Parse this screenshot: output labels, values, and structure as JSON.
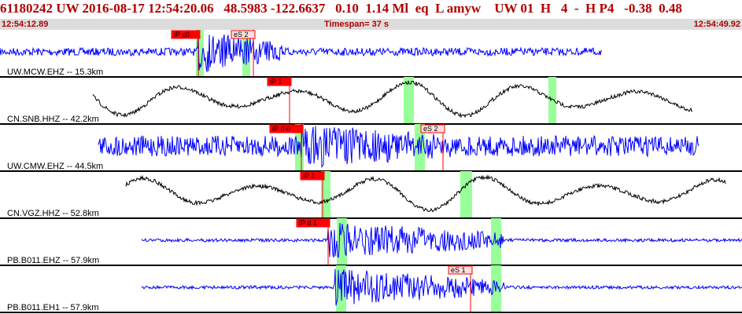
{
  "header": {
    "title": "61180242 UW 2016-08-17 12:54:20.06   48.5983 -122.6637   0.10  1.14 Ml  eq  L amyw    UW 01  H   4  -  H P4   -0.38  0.48",
    "start_time": "12:54:12.89",
    "timespan": "Timespan=  37 s",
    "end_time": "12:54:49.92"
  },
  "colors": {
    "blue": "#0000ff",
    "black": "#000000",
    "red": "#ff0000",
    "green": "#99ff99",
    "header_text": "#b00000"
  },
  "channels": [
    {
      "label": "UW.MCW.EHZ -- 15.3km",
      "color": "blue",
      "kind": "noise",
      "picks": [
        {
          "label": "iP c0",
          "type": "P"
        },
        {
          "label": "eS 2",
          "type": "S"
        }
      ]
    },
    {
      "label": "CN.SNB.HHZ -- 42.2km",
      "color": "black",
      "kind": "wave",
      "picks": [
        {
          "label": "iP 1",
          "type": "P"
        }
      ]
    },
    {
      "label": "UW.CMW.EHZ -- 44.5km",
      "color": "blue",
      "kind": "dense",
      "picks": [
        {
          "label": "iP d 0",
          "type": "P"
        },
        {
          "label": "eS 2",
          "type": "S"
        }
      ]
    },
    {
      "label": "CN.VGZ.HHZ -- 52.8km",
      "color": "black",
      "kind": "wave",
      "picks": [
        {
          "label": "iP 1",
          "type": "P"
        }
      ]
    },
    {
      "label": "PB.B011.EHZ -- 57.9km",
      "color": "blue",
      "kind": "quiet",
      "picks": [
        {
          "label": "iP d 1",
          "type": "P"
        }
      ]
    },
    {
      "label": "PB.B011.EH1 -- 57.9km",
      "color": "blue",
      "kind": "quiet",
      "picks": [
        {
          "label": "eS 1",
          "type": "S"
        }
      ]
    }
  ]
}
